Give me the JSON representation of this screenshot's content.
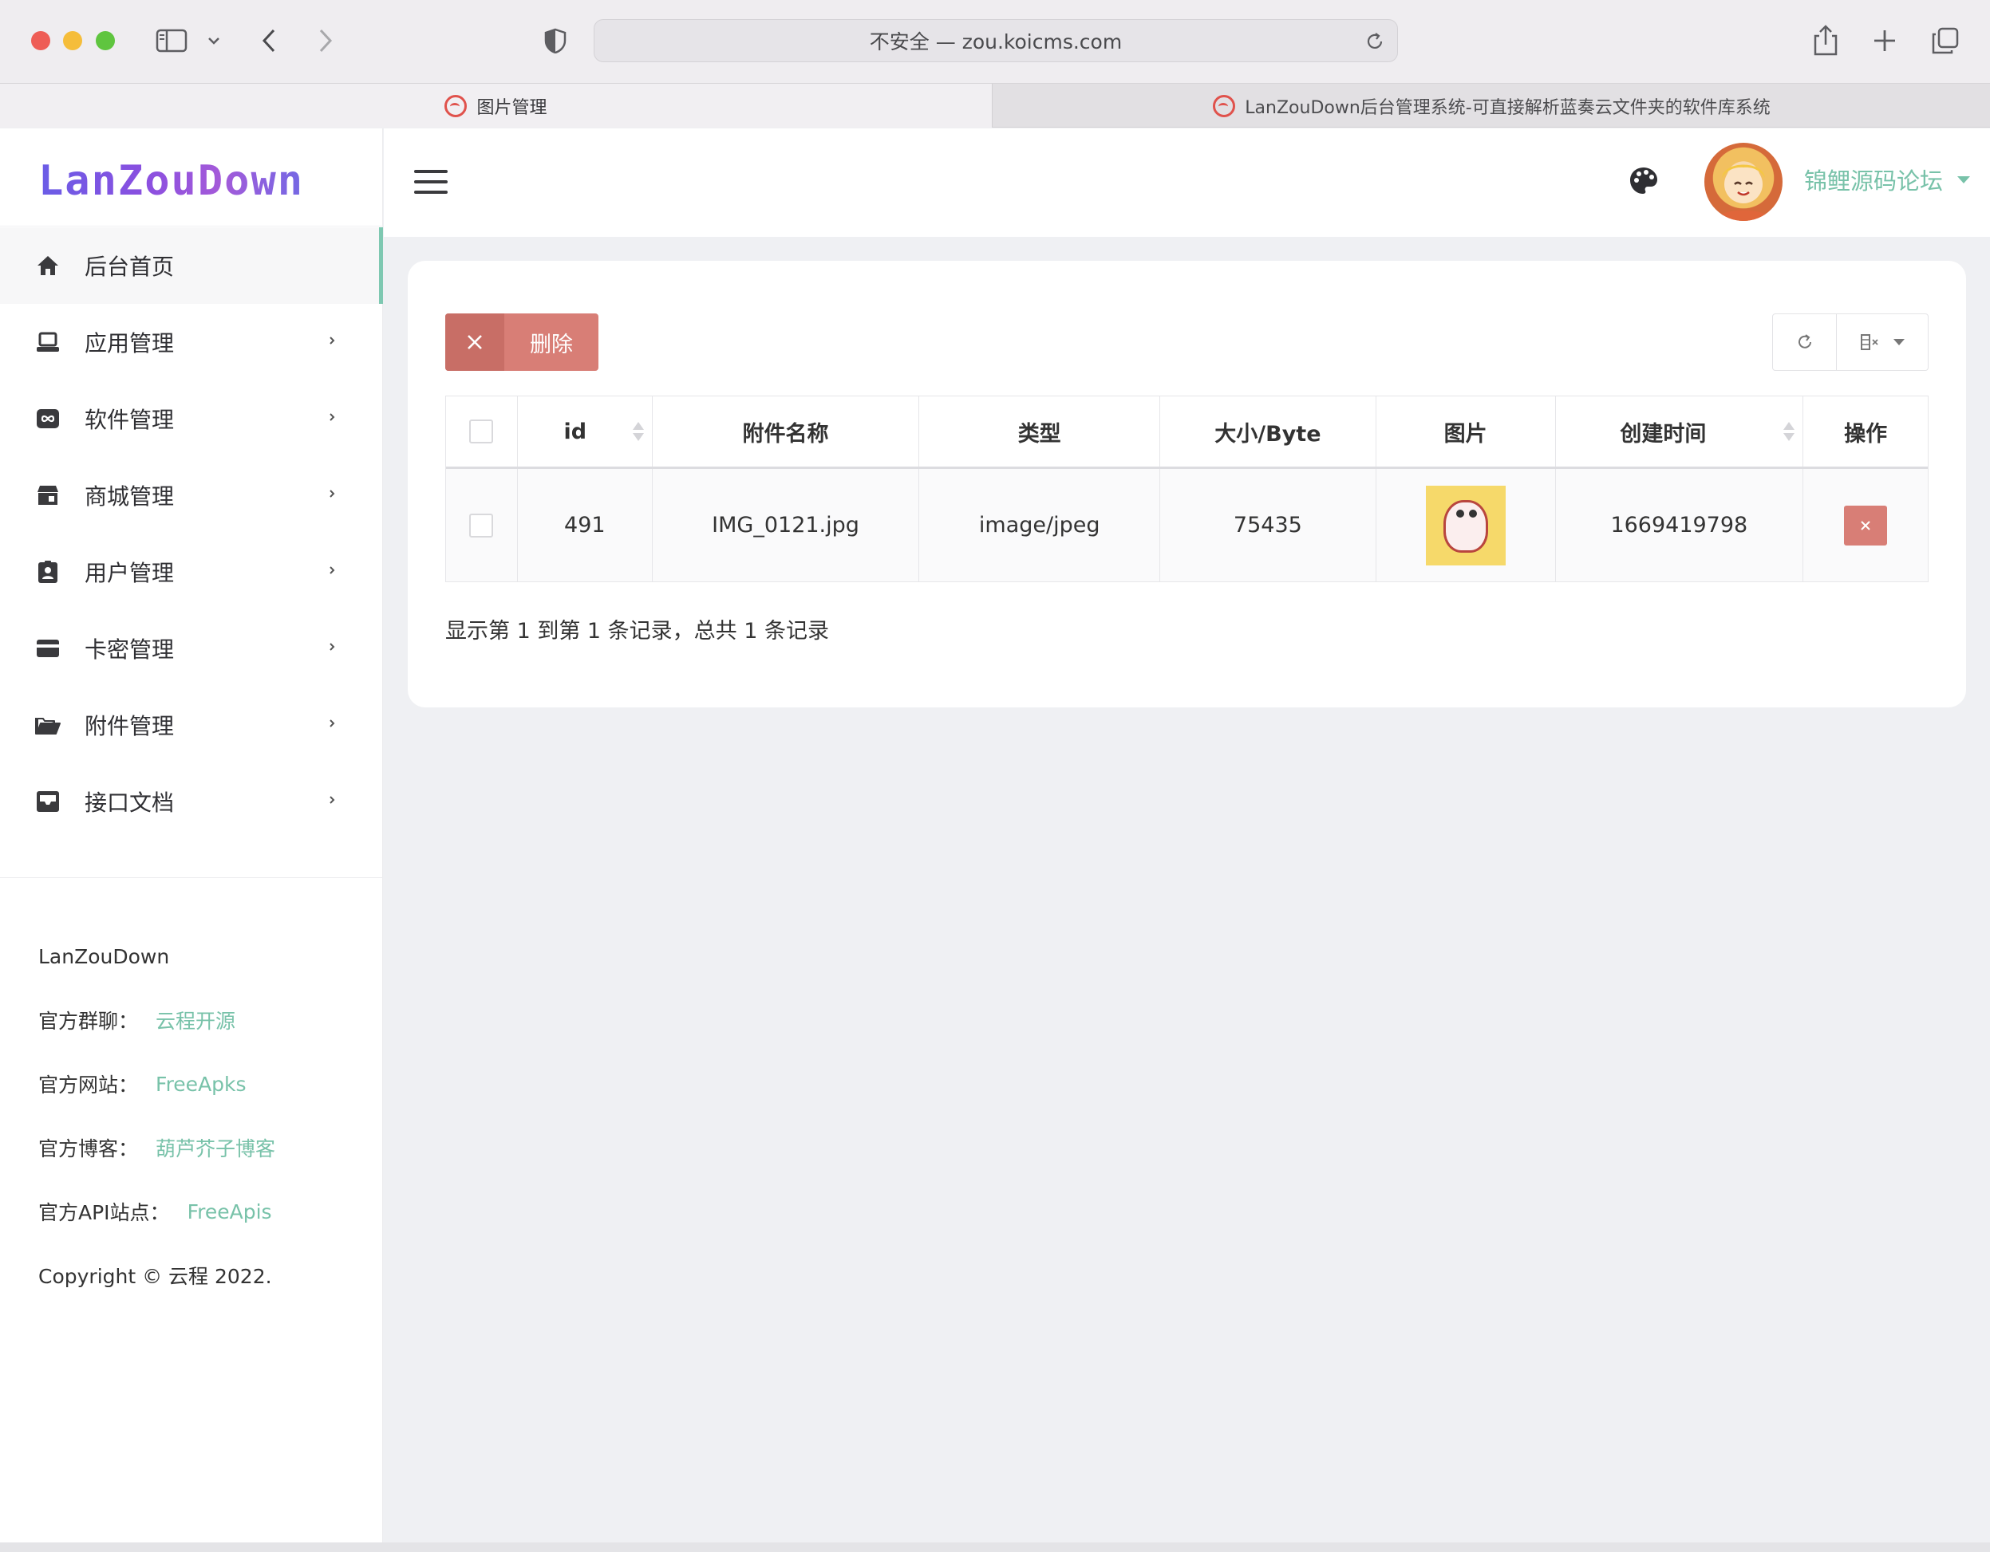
{
  "browser": {
    "url": "不安全 — zou.koicms.com",
    "tabs": [
      {
        "title": "图片管理"
      },
      {
        "title": "LanZouDown后台管理系统-可直接解析蓝奏云文件夹的软件库系统"
      }
    ]
  },
  "brand": {
    "logo_text": "LanZouDown"
  },
  "sidebar": {
    "items": [
      {
        "label": "后台首页",
        "icon": "home-icon"
      },
      {
        "label": "应用管理",
        "icon": "laptop-icon"
      },
      {
        "label": "软件管理",
        "icon": "infinity-icon"
      },
      {
        "label": "商城管理",
        "icon": "store-icon"
      },
      {
        "label": "用户管理",
        "icon": "id-badge-icon"
      },
      {
        "label": "卡密管理",
        "icon": "credit-card-icon"
      },
      {
        "label": "附件管理",
        "icon": "folder-open-icon"
      },
      {
        "label": "接口文档",
        "icon": "inbox-icon"
      }
    ],
    "footer": {
      "title": "LanZouDown",
      "links": [
        {
          "label": "官方群聊：",
          "value": "云程开源"
        },
        {
          "label": "官方网站：",
          "value": "FreeApks"
        },
        {
          "label": "官方博客：",
          "value": "葫芦芥子博客"
        },
        {
          "label": "官方API站点：",
          "value": "FreeApis"
        }
      ],
      "copyright": "Copyright © 云程 2022."
    }
  },
  "header": {
    "username": "锦鲤源码论坛"
  },
  "toolbar": {
    "delete_label": "删除"
  },
  "table": {
    "columns": [
      "id",
      "附件名称",
      "类型",
      "大小/Byte",
      "图片",
      "创建时间",
      "操作"
    ],
    "rows": [
      {
        "id": "491",
        "name": "IMG_0121.jpg",
        "type": "image/jpeg",
        "size": "75435",
        "created": "1669419798"
      }
    ],
    "summary": "显示第 1 到第 1 条记录，总共 1 条记录"
  },
  "colors": {
    "accent": "#78c2a9",
    "danger": "#d87e76",
    "logo": "#7a55e0"
  }
}
